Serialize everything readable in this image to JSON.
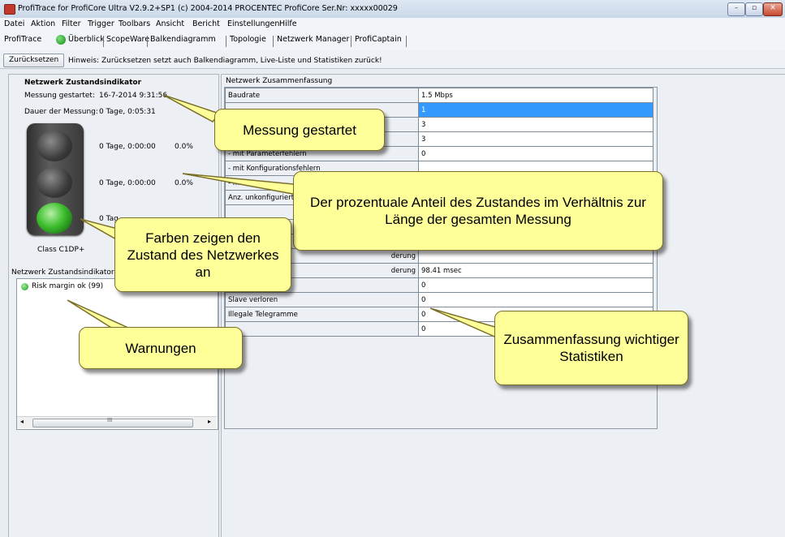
{
  "window": {
    "title": "ProfiTrace for ProfiCore Ultra V2.9.2+SP1 (c) 2004-2014 PROCENTEC  ProfiCore Ser.Nr: xxxxx00029",
    "controls": [
      "–",
      "▫",
      "✕"
    ]
  },
  "menu": [
    "Datei",
    "Aktion",
    "Filter",
    "Trigger",
    "Toolbars",
    "Ansicht",
    "Bericht",
    "Einstellungen",
    "Hilfe"
  ],
  "tabs": [
    "ProfiTrace",
    "Überblick",
    "ScopeWare",
    "Balkendiagramm",
    "Topologie",
    "Netzwerk Manager",
    "ProfiCaptain"
  ],
  "actions": {
    "reset_label": "Zurücksetzen",
    "hint": "Hinweis: Zurücksetzen setzt auch Balkendiagramm, Live-Liste und Statistiken zurück!"
  },
  "indicator": {
    "heading": "Netzwerk Zustandsindikator",
    "start_label": "Messung gestartet:",
    "start_value": "16-7-2014 9:31:56",
    "duration_label": "Dauer der Messung:",
    "duration_value": "0 Tage, 0:05:31",
    "lamps": [
      {
        "time": "0 Tage, 0:00:00",
        "percent": "0.0%",
        "state": "off"
      },
      {
        "time": "0 Tage, 0:00:00",
        "percent": "0.0%",
        "state": "off"
      },
      {
        "time": "0 Tag",
        "percent": "",
        "state": "on"
      }
    ],
    "class_label": "Class C1DP+",
    "details_heading": "Netzwerk Zustandsindikator De",
    "warnings": [
      {
        "text": "Risk margin ok (99)",
        "color": "#1a9a1a"
      }
    ],
    "scroll_glyph": "III"
  },
  "summary": {
    "heading": "Netzwerk Zusammenfassung",
    "rows": [
      {
        "label": "Baudrate",
        "value": "1.5 Mbps"
      },
      {
        "label": "",
        "value": "1",
        "selected": true
      },
      {
        "label": "",
        "value": "3"
      },
      {
        "label": "",
        "value": "3"
      },
      {
        "label": " - mit Parameterfehlern",
        "value": "0"
      },
      {
        "label": " - mit Konfigurationsfehlern",
        "value": ""
      },
      {
        "label": " - mit",
        "value": ""
      },
      {
        "label": "Anz. unkonfigurierte",
        "value": ""
      },
      {
        "label": "",
        "value": ""
      },
      {
        "label": "",
        "value": ""
      },
      {
        "label": "",
        "value": ""
      },
      {
        "label": "derung",
        "value": ""
      },
      {
        "label": "derung",
        "value": "98.41 msec"
      },
      {
        "label": "",
        "value": "0"
      },
      {
        "label": "Slave verloren",
        "value": "0"
      },
      {
        "label": "Illegale Telegramme",
        "value": "0"
      },
      {
        "label": "",
        "value": "0"
      }
    ]
  },
  "callouts": {
    "started": "Messung gestartet",
    "percent": "Der prozentuale Anteil des Zustandes im Verhältnis zur Länge der gesamten Messung",
    "colors": "Farben zeigen den Zustand des Netzwerkes an",
    "warnings": "Warnungen",
    "stats": "Zusammenfassung wichtiger Statistiken"
  }
}
